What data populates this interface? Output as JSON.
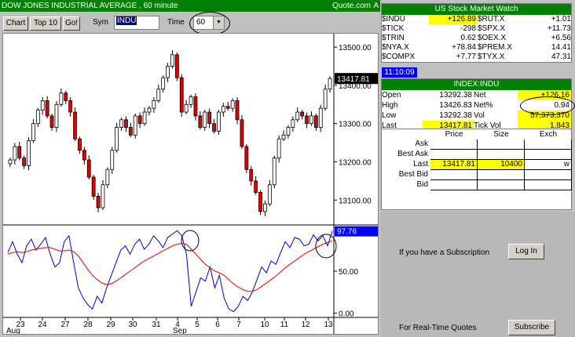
{
  "title_bar": {
    "title": "DOW JONES INDUSTRIAL AVERAGE , 60 minute",
    "source": "Quote.com",
    "flag": "A"
  },
  "toolbar": {
    "chart_label": "Chart",
    "top10_label": "Top 10",
    "go_label": "Go!",
    "sym_label": "Sym",
    "sym_value": "INDU",
    "time_label": "Time",
    "time_value": "60"
  },
  "chart_data": {
    "type": "candlestick",
    "price_axis": {
      "ticks": [
        "13500.00",
        "13400.00",
        "13300.00",
        "13200.00",
        "13100.00"
      ],
      "ylim": [
        13035,
        13535
      ]
    },
    "last_price_label": "13417.81",
    "indicator_axis": {
      "ticks": [
        "50.00",
        "0.00"
      ],
      "ylim": [
        -5,
        103
      ]
    },
    "indicator_last_label": "97.76",
    "x_ticks": [
      "23",
      "24",
      "27",
      "28",
      "29",
      "30",
      "31",
      "4",
      "5",
      "6",
      "7",
      "10",
      "11",
      "12",
      "13"
    ],
    "month_labels": [
      "Aug",
      "Sep"
    ],
    "closes": [
      13205,
      13240,
      13210,
      13190,
      13255,
      13300,
      13335,
      13360,
      13320,
      13290,
      13350,
      13380,
      13360,
      13330,
      13260,
      13230,
      13205,
      13160,
      13110,
      13080,
      13140,
      13180,
      13230,
      13290,
      13310,
      13290,
      13270,
      13320,
      13300,
      13330,
      13340,
      13360,
      13390,
      13420,
      13450,
      13480,
      13420,
      13330,
      13350,
      13370,
      13320,
      13290,
      13330,
      13300,
      13280,
      13330,
      13345,
      13340,
      13360,
      13310,
      13240,
      13180,
      13150,
      13120,
      13070,
      13090,
      13140,
      13210,
      13260,
      13270,
      13290,
      13310,
      13330,
      13320,
      13300,
      13320,
      13290,
      13340,
      13390,
      13417.81
    ],
    "series": [
      {
        "name": "fast",
        "color": "#0000c0",
        "values": [
          72,
          85,
          70,
          60,
          80,
          88,
          75,
          82,
          90,
          70,
          55,
          60,
          85,
          92,
          60,
          30,
          18,
          10,
          5,
          20,
          12,
          30,
          45,
          60,
          75,
          80,
          70,
          82,
          88,
          76,
          82,
          92,
          86,
          78,
          90,
          94,
          98,
          92,
          70,
          8,
          25,
          42,
          38,
          55,
          30,
          45,
          18,
          5,
          2,
          8,
          20,
          15,
          25,
          40,
          55,
          48,
          62,
          58,
          72,
          85,
          78,
          90,
          88,
          80,
          82,
          93,
          86,
          92,
          80,
          97.76
        ]
      },
      {
        "name": "slow",
        "color": "#e00000",
        "values": [
          70,
          72,
          73,
          72,
          73,
          75,
          76,
          77,
          78,
          78,
          76,
          74,
          74,
          75,
          73,
          68,
          60,
          52,
          45,
          40,
          36,
          34,
          35,
          38,
          42,
          46,
          50,
          54,
          58,
          62,
          65,
          68,
          71,
          74,
          77,
          80,
          82,
          83,
          82,
          76,
          70,
          64,
          58,
          54,
          50,
          48,
          45,
          40,
          35,
          31,
          28,
          26,
          26,
          28,
          32,
          36,
          40,
          44,
          49,
          54,
          58,
          62,
          66,
          70,
          73,
          76,
          79,
          82,
          84,
          86
        ]
      }
    ]
  },
  "watch": {
    "header": "US Stock Market Watch",
    "rows": [
      [
        "$INDU",
        "+126.89",
        "$RUT.X",
        "+1.01"
      ],
      [
        "$TICK",
        "-298",
        "$SPX.X",
        "+11.73"
      ],
      [
        "$TRIN",
        "0.62",
        "$OEX.X",
        "+6.56"
      ],
      [
        "$NYA.X",
        "+78.84",
        "$PREM.X",
        "14.41"
      ],
      [
        "$COMPX",
        "+7.77",
        "$TYX.X",
        "47.31"
      ]
    ]
  },
  "time_badge": "11:10:09",
  "index": {
    "header": "INDEX:INDU",
    "rows": [
      [
        "Open",
        "13292.38",
        "Net",
        "+126.16"
      ],
      [
        "High",
        "13426.83",
        "Net%",
        "0.94"
      ],
      [
        "Low",
        "13292.38",
        "Vol",
        "57,373,370"
      ],
      [
        "Last",
        "13417.81",
        "Tick Vol",
        "1,843"
      ]
    ]
  },
  "quotes": {
    "headers": [
      "Price",
      "Size",
      "Exch"
    ],
    "rows": [
      {
        "label": "Ask",
        "price": "",
        "size": "",
        "exch": ""
      },
      {
        "label": "Best Ask",
        "price": "",
        "size": "",
        "exch": ""
      },
      {
        "label": "Last",
        "price": "13417.81",
        "size": "10400",
        "exch": "w"
      },
      {
        "label": "Best Bid",
        "price": "",
        "size": "",
        "exch": ""
      },
      {
        "label": "Bid",
        "price": "",
        "size": "",
        "exch": ""
      }
    ]
  },
  "subscription": {
    "text": "If you have a Subscription",
    "login_label": "Log In",
    "realtime_text": "For Real-Time Quotes",
    "subscribe_label": "Subscribe"
  }
}
